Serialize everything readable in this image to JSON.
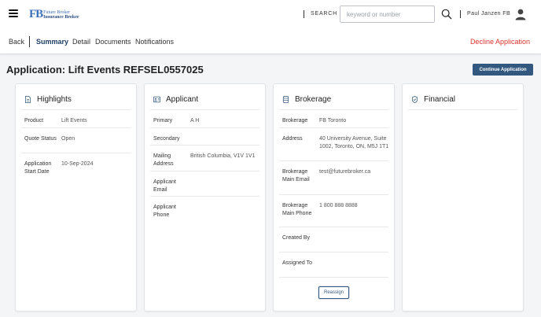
{
  "header": {
    "logo_mark": "FB",
    "logo_line1": "Future Broker",
    "logo_line2": "Insurance Broker",
    "search_label": "SEARCH",
    "search_placeholder": "keyword or number",
    "search_value": "",
    "user_name": "Paul Janzen FB"
  },
  "subnav": {
    "back": "Back",
    "tabs": [
      "Summary",
      "Detail",
      "Documents",
      "Notifications"
    ],
    "active_tab": "Summary",
    "decline": "Decline Application"
  },
  "page": {
    "title": "Application: Lift Events REFSEL0557025",
    "continue_button": "Continue Application"
  },
  "highlights": {
    "title": "Highlights",
    "rows": [
      {
        "label": "Product",
        "value": "Lift Events"
      },
      {
        "label": "Quote Status",
        "value": "Open"
      },
      {
        "label": "Application Start Date",
        "value": "10-Sep-2024"
      }
    ]
  },
  "applicant": {
    "title": "Applicant",
    "rows": [
      {
        "label": "Primary",
        "value": "A H"
      },
      {
        "label": "Secondary",
        "value": ""
      },
      {
        "label": "Mailing Address",
        "value": "British Columbia, V1V 1V1"
      },
      {
        "label": "Applicant Email",
        "value": ""
      },
      {
        "label": "Applicant Phone",
        "value": ""
      }
    ]
  },
  "brokerage": {
    "title": "Brokerage",
    "rows": [
      {
        "label": "Brokerage",
        "value": "FB Toronto"
      },
      {
        "label": "Address",
        "value": "40 University Avenue, Suite 1002, Toronto, ON, M5J 1T1"
      },
      {
        "label": "Brokerage Main Email",
        "value": "test@futurebroker.ca"
      },
      {
        "label": "Brokerage Main Phone",
        "value": "1 800 888 8888"
      },
      {
        "label": "Created By",
        "value": ""
      },
      {
        "label": "Assigned To",
        "value": ""
      }
    ],
    "reassign_button": "Reassign"
  },
  "financial": {
    "title": "Financial"
  },
  "colors": {
    "primary": "#33587f",
    "danger": "#d9342b",
    "logo_blue": "#3d6fb8"
  }
}
